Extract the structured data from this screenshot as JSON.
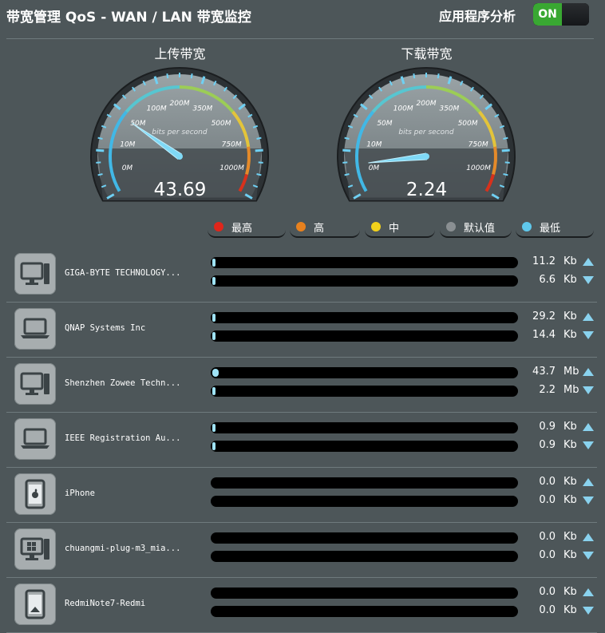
{
  "header": {
    "title": "带宽管理 QoS - WAN / LAN 带宽监控",
    "app_analysis_label": "应用程序分析",
    "toggle_label": "ON"
  },
  "gauges": {
    "unit_label": "bits per second",
    "scale_labels": [
      "0M",
      "10M",
      "50M",
      "100M",
      "200M",
      "350M",
      "500M",
      "750M",
      "1000M"
    ],
    "upload": {
      "label": "上传带宽",
      "value": "43.69"
    },
    "download": {
      "label": "下载带宽",
      "value": "2.24"
    }
  },
  "legend": [
    {
      "label": "最高",
      "color": "#e0261b"
    },
    {
      "label": "高",
      "color": "#e8811e"
    },
    {
      "label": "中",
      "color": "#f2d11b"
    },
    {
      "label": "默认值",
      "color": "#8a8f92"
    },
    {
      "label": "最低",
      "color": "#5fc8ec"
    }
  ],
  "devices": [
    {
      "name": "GIGA-BYTE TECHNOLOGY...",
      "icon": "desktop-icon",
      "up": "11.2",
      "up_unit": "Kb",
      "down": "6.6",
      "down_unit": "Kb",
      "up_fill": 0.01,
      "down_fill": 0.01
    },
    {
      "name": "QNAP Systems Inc",
      "icon": "laptop-icon",
      "up": "29.2",
      "up_unit": "Kb",
      "down": "14.4",
      "down_unit": "Kb",
      "up_fill": 0.01,
      "down_fill": 0.01
    },
    {
      "name": "Shenzhen Zowee Techn...",
      "icon": "desktop-icon",
      "up": "43.7",
      "up_unit": "Mb",
      "down": "2.2",
      "down_unit": "Mb",
      "up_fill": 0.02,
      "down_fill": 0.01
    },
    {
      "name": "IEEE Registration Au...",
      "icon": "laptop-icon",
      "up": "0.9",
      "up_unit": "Kb",
      "down": "0.9",
      "down_unit": "Kb",
      "up_fill": 0.003,
      "down_fill": 0.003
    },
    {
      "name": "iPhone",
      "icon": "apple-phone-icon",
      "up": "0.0",
      "up_unit": "Kb",
      "down": "0.0",
      "down_unit": "Kb",
      "up_fill": 0,
      "down_fill": 0
    },
    {
      "name": "chuangmi-plug-m3_mia...",
      "icon": "windows-desktop-icon",
      "up": "0.0",
      "up_unit": "Kb",
      "down": "0.0",
      "down_unit": "Kb",
      "up_fill": 0,
      "down_fill": 0
    },
    {
      "name": "RedmiNote7-Redmi",
      "icon": "android-phone-icon",
      "up": "0.0",
      "up_unit": "Kb",
      "down": "0.0",
      "down_unit": "Kb",
      "up_fill": 0,
      "down_fill": 0
    }
  ]
}
